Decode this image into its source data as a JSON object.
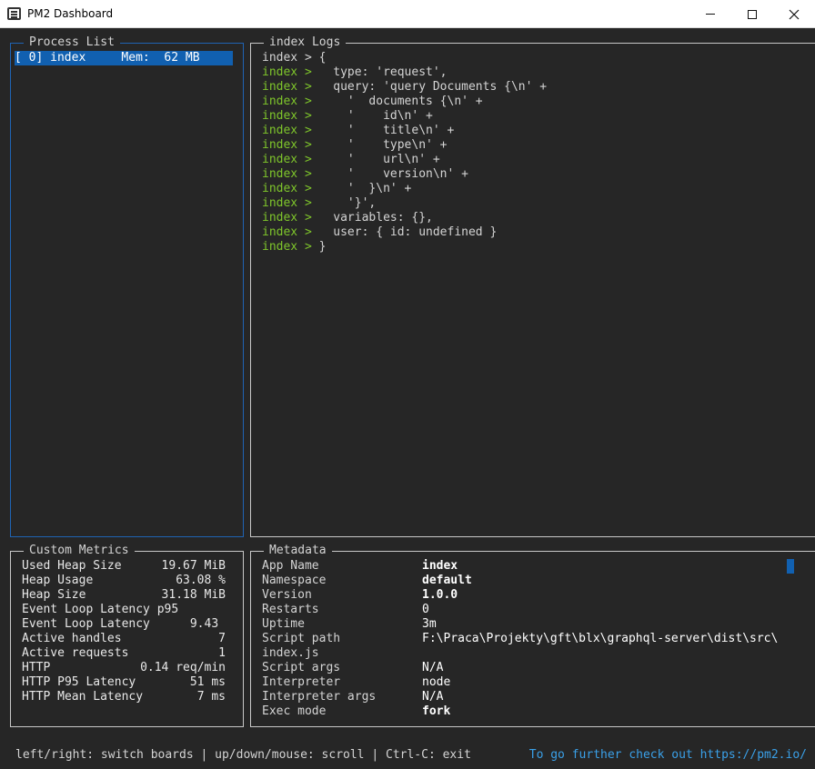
{
  "window": {
    "title": "PM2 Dashboard"
  },
  "process_list": {
    "title": "Process List",
    "items": [
      {
        "id_label": "[ 0]",
        "name": "index",
        "mem_label": "Mem:",
        "mem_value": "62 MB"
      }
    ]
  },
  "logs": {
    "title": "index Logs",
    "lines": [
      {
        "prefix": "index >",
        "text": " {"
      },
      {
        "prefix": "index >",
        "text": "   type: 'request',"
      },
      {
        "prefix": "index >",
        "text": "   query: 'query Documents {\\n' +"
      },
      {
        "prefix": "index >",
        "text": "     '  documents {\\n' +"
      },
      {
        "prefix": "index >",
        "text": "     '    id\\n' +"
      },
      {
        "prefix": "index >",
        "text": "     '    title\\n' +"
      },
      {
        "prefix": "index >",
        "text": "     '    type\\n' +"
      },
      {
        "prefix": "index >",
        "text": "     '    url\\n' +"
      },
      {
        "prefix": "index >",
        "text": "     '    version\\n' +"
      },
      {
        "prefix": "index >",
        "text": "     '  }\\n' +"
      },
      {
        "prefix": "index >",
        "text": "     '}',"
      },
      {
        "prefix": "index >",
        "text": "   variables: {},"
      },
      {
        "prefix": "index >",
        "text": "   user: { id: undefined }"
      },
      {
        "prefix": "index >",
        "text": " }"
      }
    ]
  },
  "metrics": {
    "title": "Custom Metrics",
    "rows": [
      {
        "label": "Used Heap Size",
        "value": "19.67 MiB"
      },
      {
        "label": "Heap Usage",
        "value": "63.08 %"
      },
      {
        "label": "Heap Size",
        "value": "31.18 MiB"
      },
      {
        "label": "Event Loop Latency p95",
        "value": ""
      },
      {
        "label": "Event Loop Latency",
        "value": "9.43 "
      },
      {
        "label": "Active handles",
        "value": "7"
      },
      {
        "label": "Active requests",
        "value": "1"
      },
      {
        "label": "HTTP",
        "value": "0.14 req/min"
      },
      {
        "label": "HTTP P95 Latency",
        "value": "51 ms"
      },
      {
        "label": "HTTP Mean Latency",
        "value": "7 ms"
      }
    ]
  },
  "metadata": {
    "title": "Metadata",
    "rows": [
      {
        "key": "App Name",
        "value": "index"
      },
      {
        "key": "Namespace",
        "value": "default"
      },
      {
        "key": "Version",
        "value": "1.0.0"
      },
      {
        "key": "Restarts",
        "value": "0"
      },
      {
        "key": "Uptime",
        "value": "3m"
      },
      {
        "key": "Script path",
        "value": "F:\\Praca\\Projekty\\gft\\blx\\graphql-server\\dist\\src\\"
      },
      {
        "key": "index.js",
        "value": ""
      },
      {
        "key": "Script args",
        "value": "N/A"
      },
      {
        "key": "Interpreter",
        "value": "node"
      },
      {
        "key": "Interpreter args",
        "value": "N/A"
      },
      {
        "key": "Exec mode",
        "value": "fork"
      }
    ]
  },
  "footer": {
    "hint": "left/right: switch boards | up/down/mouse: scroll | Ctrl-C: exit",
    "link": "To go further check out https://pm2.io/"
  },
  "colors": {
    "background": "#262626",
    "selection": "#1160b0",
    "log_prefix": "#7fc62b",
    "link": "#3aa0e8",
    "focus_border": "#1f64b3"
  }
}
